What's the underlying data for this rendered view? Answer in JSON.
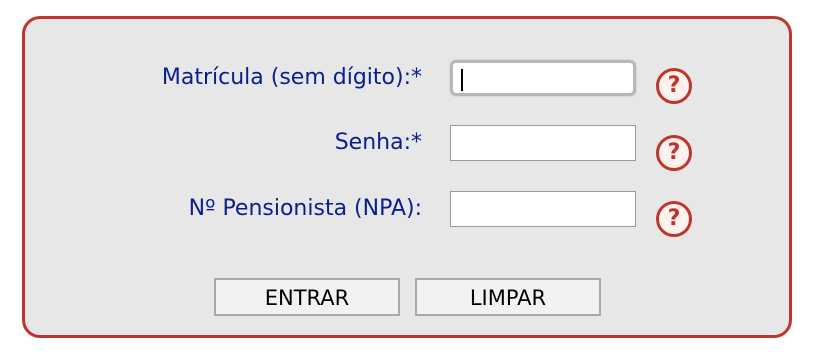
{
  "form": {
    "fields": [
      {
        "label": "Matrícula (sem dígito):*",
        "value": "",
        "help_icon": "question-icon"
      },
      {
        "label": "Senha:*",
        "value": "",
        "help_icon": "question-icon"
      },
      {
        "label": "Nº Pensionista (NPA):",
        "value": "",
        "help_icon": "question-icon"
      }
    ],
    "help_glyph": "?",
    "buttons": {
      "submit_label": "ENTRAR",
      "clear_label": "LIMPAR"
    }
  },
  "colors": {
    "border_accent": "#c0352b",
    "label_text": "#0a1f8f",
    "panel_background": "#e7e7e7"
  }
}
